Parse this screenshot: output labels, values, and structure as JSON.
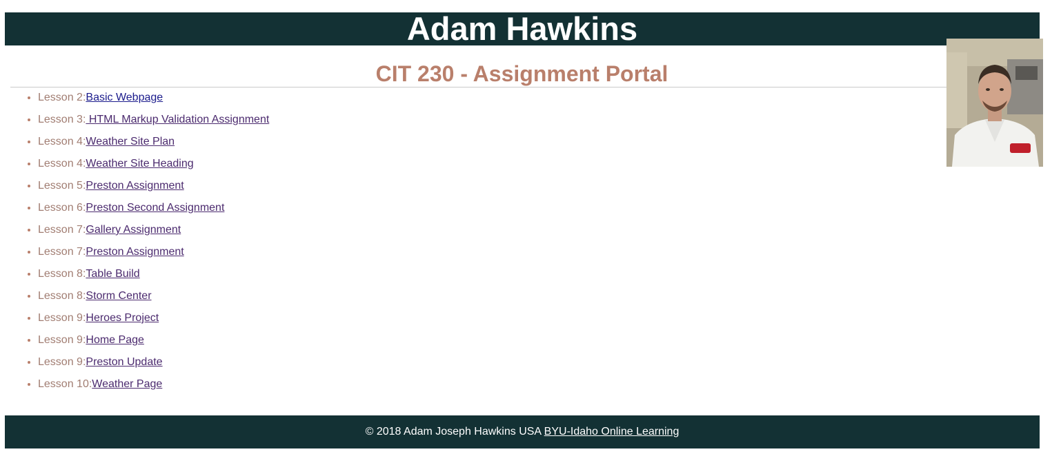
{
  "header": {
    "title": "Adam Hawkins"
  },
  "subtitle": "CIT 230 - Assignment Portal",
  "lessons": [
    {
      "label": "Lesson 2:",
      "link": "Basic Webpage"
    },
    {
      "label": "Lesson 3:",
      "link": " HTML Markup Validation Assignment"
    },
    {
      "label": "Lesson 4:",
      "link": "Weather Site Plan"
    },
    {
      "label": "Lesson 4:",
      "link": "Weather Site Heading"
    },
    {
      "label": "Lesson 5:",
      "link": "Preston Assignment"
    },
    {
      "label": "Lesson 6:",
      "link": "Preston Second Assignment"
    },
    {
      "label": "Lesson 7:",
      "link": "Gallery Assignment"
    },
    {
      "label": "Lesson 7:",
      "link": "Preston Assignment"
    },
    {
      "label": "Lesson 8:",
      "link": "Table Build"
    },
    {
      "label": "Lesson 8:",
      "link": "Storm Center"
    },
    {
      "label": "Lesson 9:",
      "link": "Heroes Project"
    },
    {
      "label": "Lesson 9:",
      "link": "Home Page"
    },
    {
      "label": "Lesson 9:",
      "link": "Preston Update"
    },
    {
      "label": "Lesson 10:",
      "link": "Weather Page"
    }
  ],
  "footer": {
    "text": "© 2018 Adam Joseph Hawkins USA ",
    "link": "BYU-Idaho Online Learning"
  },
  "colors": {
    "header_bg": "#133134",
    "accent": "#b97f6b",
    "visited_link": "#4b2a6e",
    "link": "#1b1b8c"
  }
}
